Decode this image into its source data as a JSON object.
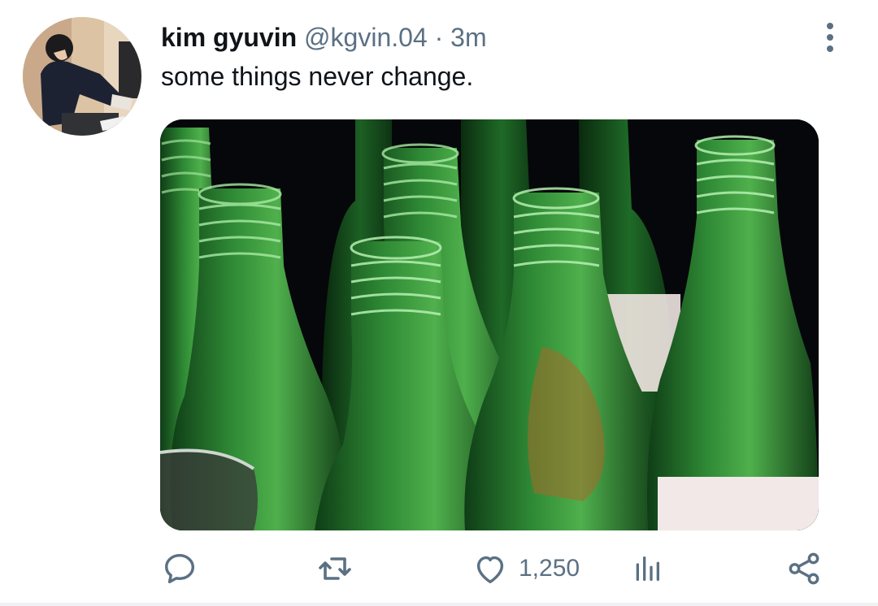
{
  "tweet": {
    "display_name": "kim gyuvin",
    "handle": "@kgvin.04",
    "separator": "·",
    "time": "3m",
    "text": "some things never change."
  },
  "actions": {
    "like_count": "1,250"
  },
  "icons": {
    "avatar": "profile-photo",
    "more": "vertical-ellipsis-icon",
    "reply": "speech-bubble-icon",
    "retweet": "retweet-icon",
    "like": "heart-icon",
    "analytics": "bar-chart-icon",
    "share": "share-icon"
  },
  "colors": {
    "text_primary": "#0f1419",
    "text_secondary": "#5b7083",
    "bottle_green": "#2f8a35"
  }
}
